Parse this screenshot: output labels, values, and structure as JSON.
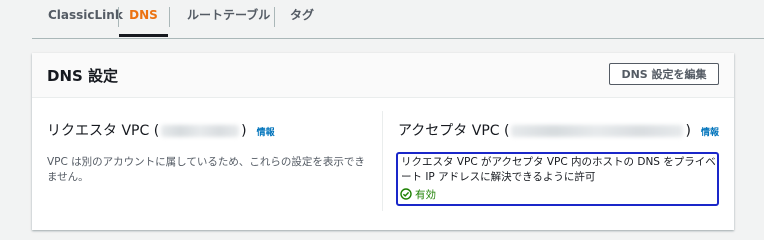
{
  "tabs": [
    {
      "label": "ClassicLink",
      "active": false
    },
    {
      "label": "DNS",
      "active": true
    },
    {
      "label": "ルートテーブル",
      "active": false
    },
    {
      "label": "タグ",
      "active": false
    }
  ],
  "panel": {
    "title": "DNS 設定",
    "edit_button": "DNS 設定を編集",
    "requester": {
      "title_prefix": "リクエスタ VPC (",
      "title_suffix": ")",
      "info": "情報",
      "text": "VPC は別のアカウントに属しているため、これらの設定を表示できません。"
    },
    "accepter": {
      "title_prefix": "アクセプタ VPC (",
      "title_suffix": ")",
      "info": "情報",
      "text": "リクエスタ VPC がアクセプタ VPC 内のホストの DNS をプライベート IP アドレスに解決できるように許可",
      "status": "有効"
    }
  },
  "colors": {
    "accent": "#ec7211",
    "link": "#0073bb",
    "success": "#1d8102",
    "highlight": "#1a27c9"
  }
}
